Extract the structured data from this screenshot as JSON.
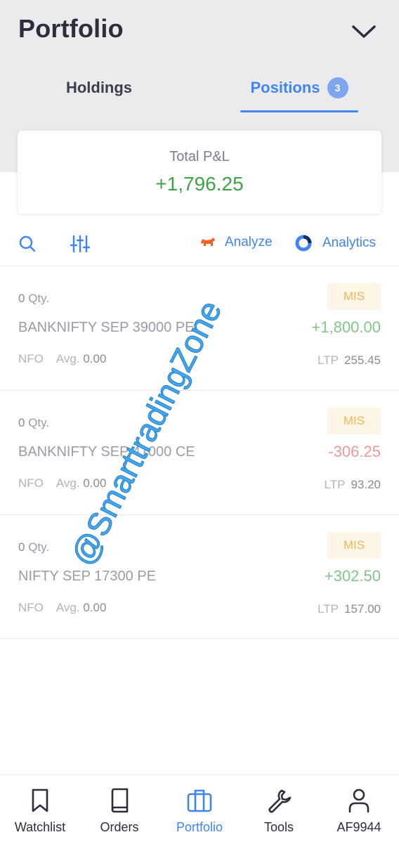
{
  "header": {
    "title": "Portfolio"
  },
  "tabs": [
    {
      "label": "Holdings"
    },
    {
      "label": "Positions",
      "badge": "3",
      "active": true
    }
  ],
  "summary": {
    "label": "Total P&L",
    "value": "+1,796.25"
  },
  "toolbar": {
    "analyze_label": "Analyze",
    "analytics_label": "Analytics"
  },
  "positions": [
    {
      "qty": "0",
      "qty_label": "Qty.",
      "instrument": "BANKNIFTY SEP 39000 PE",
      "exchange": "NFO",
      "avg_label": "Avg.",
      "avg": "0.00",
      "product": "MIS",
      "pnl": "+1,800.00",
      "ltp_label": "LTP",
      "ltp": "255.45"
    },
    {
      "qty": "0",
      "qty_label": "Qty.",
      "instrument": "BANKNIFTY SEP 41000 CE",
      "exchange": "NFO",
      "avg_label": "Avg.",
      "avg": "0.00",
      "product": "MIS",
      "pnl": "-306.25",
      "ltp_label": "LTP",
      "ltp": "93.20"
    },
    {
      "qty": "0",
      "qty_label": "Qty.",
      "instrument": "NIFTY SEP 17300 PE",
      "exchange": "NFO",
      "avg_label": "Avg.",
      "avg": "0.00",
      "product": "MIS",
      "pnl": "+302.50",
      "ltp_label": "LTP",
      "ltp": "157.00"
    }
  ],
  "watermark": "@SmarttradingZone",
  "bottom_nav": [
    {
      "label": "Watchlist",
      "icon": "bookmark-icon"
    },
    {
      "label": "Orders",
      "icon": "book-icon"
    },
    {
      "label": "Portfolio",
      "icon": "briefcase-icon",
      "active": true
    },
    {
      "label": "Tools",
      "icon": "wrench-icon"
    },
    {
      "label": "AF9944",
      "icon": "user-icon"
    }
  ],
  "colors": {
    "accent": "#4184f3",
    "profit": "#3fa348",
    "loss": "#ea9a9a",
    "mis": "#f2b75a"
  }
}
